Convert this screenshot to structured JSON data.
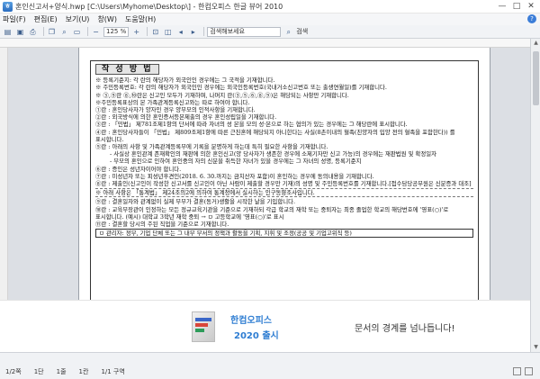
{
  "window": {
    "title": "혼인신고서+양식.hwp [C:\\Users\\Myhome\\Desktop\\] - 한컴오피스 한글 뷰어 2010",
    "app_icon_label": "ㅎ",
    "controls": [
      "—",
      "□",
      "✕"
    ]
  },
  "menu": {
    "items": [
      "파일(F)",
      "편집(E)",
      "보기(U)",
      "창(W)",
      "도움말(H)"
    ],
    "help_icon": "?"
  },
  "toolbar": {
    "zoom_value": "125 %",
    "search_placeholder": "검색해보세요",
    "search_button": "검색",
    "icons": [
      "open-icon",
      "save-icon",
      "print-icon",
      "copy-icon",
      "find-icon",
      "page-icon",
      "zoom-in-icon",
      "zoom-out-icon"
    ]
  },
  "document": {
    "title": "작 성 방 법",
    "lines": [
      {
        "text": "※ 등록기준지: 각 란의 해당자가 외국인인 경우에는 그 국적을 기재합니다.",
        "style": ""
      },
      {
        "text": "※ 주민등록번호: 각 란의 해당자가 외국인인 경우에는 외국인등록번호(국내거소신고번호 또는 출생연월일)를 기재합니다.",
        "style": ""
      },
      {
        "text": "※ ③,⑤란 ⑧,⑩란은 신고인 모두가 기재하며, 나머지 란(③,⑤,⑥,⑧,⑨)은 해당되는 사항만 기재합니다.",
        "style": ""
      },
      {
        "text": "※주민등록표상의 본 가족관계등록신고와는 따로 하여야 합니다.",
        "style": ""
      },
      {
        "text": "①란 : 혼인당사자가 양자인 경우 양부모의 인적사항을 기재합니다.",
        "style": ""
      },
      {
        "text": "②란 : 외국방식에 의한 혼인증서등본제출의 경우 혼인성립일을 기재합니다.",
        "style": ""
      },
      {
        "text": "③란 : 「민법」 제781조제1항의 단서에 따라 자녀의 성 본을 모의 성·본으로 하는 협의가 있는 경우에는 그 해당란에 표시합니다.",
        "style": ""
      },
      {
        "text": "④란 : 혼인당사자들이 「민법」 제809조제1항에 따른 근친혼에 해당되지 아니한다는 사실(8촌이내의 혈족(친양자의 입양 전의 혈족을 포함한다)) 를 표시합니다.",
        "style": ""
      },
      {
        "text": "⑤란 : 아래의 사항 및 가족관계등록부에 기록을 분명하게 하는데 특히 필요한 사항을 기재합니다.",
        "style": ""
      },
      {
        "text": "- 사실상 혼인관계 존재확인의 재판에 의한 혼인신고(양 당사자가 생존한 경우에 소제기자만 신고 가능)의 경우에는 재판법원 및 확정일자",
        "style": "indent"
      },
      {
        "text": "- 부모의 혼인으로 인하여 혼인중의 자의 신분을 취득한 자녀가 있을 경우에는 그 자녀의 성명, 등록기준지",
        "style": "indent"
      },
      {
        "text": "⑥란 : 증인은 성년자이어야 합니다.",
        "style": ""
      },
      {
        "text": "⑦란 : 미성년자 또는 피성년후견인(2018. 6. 30.까지는 금치산자 포함)이 혼인하는 경우에 동의내용을 기재합니다.",
        "style": ""
      },
      {
        "text": "⑧란 : 제출인(신고인이 작성한 신고서를 신고인이 아닌 사람이 제출할 경우만 기재)의 성명 및 주민등록번호를 기재합니다.[접수담당공무원은 신분증과 대조]",
        "style": ""
      },
      {
        "text": "※ 아래 사항은 「통계법」 제24조의2에 의하여 통계청에서 실시하는 인구동향조사입니다.",
        "style": "hl"
      },
      {
        "text": "⑨란 : 결혼일자와 관계없이 실제 부부가 결혼(동거)생활을 시작한 날을 기입합니다.",
        "style": ""
      },
      {
        "text": "⑩란 : 교육부장관이 인정하는 모든 정규교육기관을 기준으로 기재하되 각급 학교의 재학 또는 중퇴자는 최종 졸업한 학교의 해당번호에 '영표(○)'로 표시합니다. (예시) 대학교 3학년 재학 중퇴 → ㅁ 고등학교에 '영표(○)'로 표시",
        "style": ""
      },
      {
        "text": "⑪란 : 결혼할 당시의 주된 직업을 기준으로 기재합니다.",
        "style": ""
      },
      {
        "text": "ㅁ 관리자: 정부, 기업 단체 또는 그 내부 부서의 정책과 활동을 기획, 지휘 및 조정(공공 및 기업고위직 등)",
        "style": "boxed"
      }
    ]
  },
  "ad": {
    "product_name": "한컴오피스",
    "product_year": "2020 출시",
    "tagline": "문서의 경계를 넘나듭니다!"
  },
  "status": {
    "items": [
      "1/2쪽",
      "1단",
      "1줄",
      "1칸",
      "1/1 구역"
    ]
  }
}
